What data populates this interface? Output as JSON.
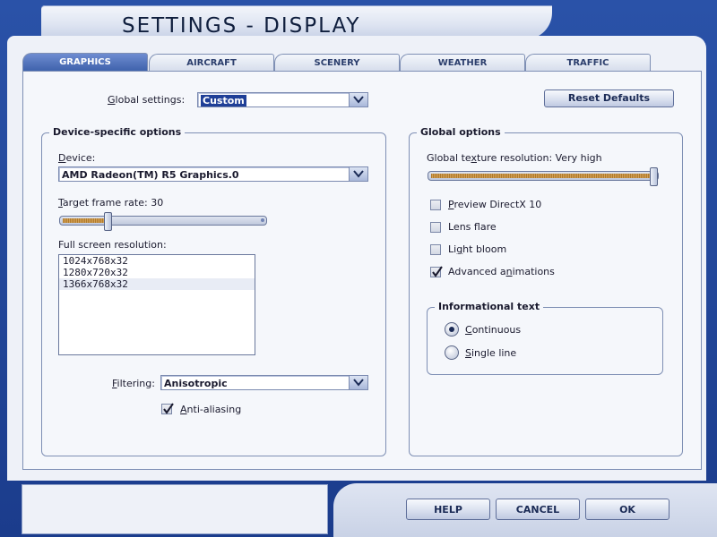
{
  "window": {
    "title": "SETTINGS - DISPLAY"
  },
  "tabs": [
    {
      "label": "GRAPHICS",
      "active": true
    },
    {
      "label": "AIRCRAFT",
      "active": false
    },
    {
      "label": "SCENERY",
      "active": false
    },
    {
      "label": "WEATHER",
      "active": false
    },
    {
      "label": "TRAFFIC",
      "active": false
    }
  ],
  "global_settings": {
    "label_first": "G",
    "label_rest": "lobal settings:",
    "value": "Custom",
    "reset_button": "Reset Defaults"
  },
  "device_options": {
    "title": "Device-specific options",
    "device_label_first": "D",
    "device_label_rest": "evice:",
    "device_value": "AMD Radeon(TM) R5 Graphics.0",
    "frame_rate_label_first": "T",
    "frame_rate_label_rest": "arget frame rate: 30",
    "frame_rate_level": 0.22,
    "resolution_label": "Full screen resolution:",
    "resolutions": [
      "1024x768x32",
      "1280x720x32",
      "1366x768x32"
    ],
    "selected_resolution": 2,
    "filtering_label_first": "F",
    "filtering_label_rest": "iltering:",
    "filtering_value": "Anisotropic",
    "antialiasing_label_first": "A",
    "antialiasing_label_rest": "nti-aliasing",
    "antialiasing_checked": true
  },
  "global_options": {
    "title": "Global options",
    "texture_label_pre": "Global te",
    "texture_label_u": "x",
    "texture_label_post": "ture resolution: Very high",
    "texture_level": 1.0,
    "checkboxes": [
      {
        "pre": "",
        "u": "P",
        "post": "review DirectX 10",
        "checked": false
      },
      {
        "pre": "Lens f",
        "u": "l",
        "post": "are",
        "checked": false
      },
      {
        "pre": "Li",
        "u": "g",
        "post": "ht bloom",
        "checked": false
      },
      {
        "pre": "Advanced a",
        "u": "n",
        "post": "imations",
        "checked": true
      }
    ],
    "info_text": {
      "title": "Informational text",
      "options": [
        {
          "u": "C",
          "post": "ontinuous",
          "selected": true
        },
        {
          "u": "S",
          "post": "ingle line",
          "selected": false
        }
      ]
    }
  },
  "footer": {
    "help": "HELP",
    "cancel": "CANCEL",
    "ok": "OK"
  },
  "colors": {
    "frame": "#1e3f8f",
    "panel": "#f5f7fb",
    "selection": "#1f3f97",
    "slider_fill": "#d3a158"
  }
}
